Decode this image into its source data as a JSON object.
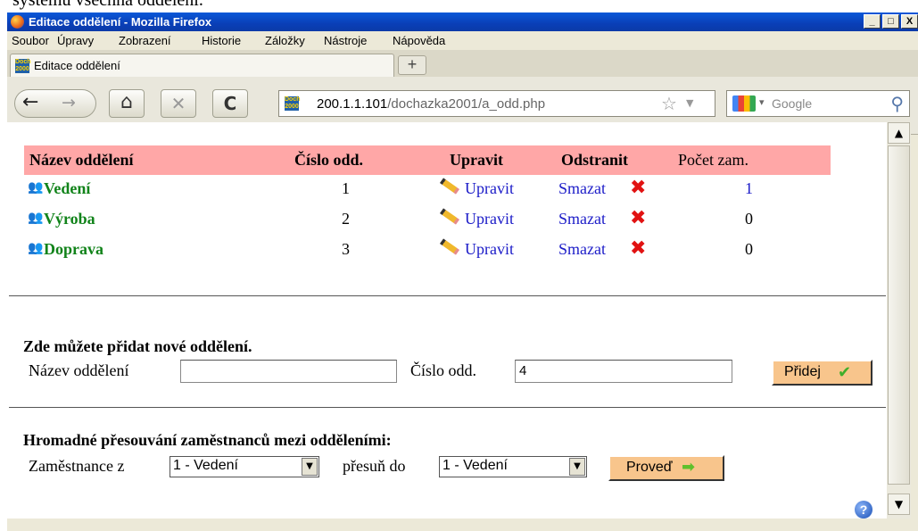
{
  "doc_cut_text": "systému všechna oddělení.",
  "window": {
    "title": "Editace oddělení - Mozilla Firefox",
    "min": "_",
    "max": "□",
    "close": "X"
  },
  "menu": {
    "items": [
      "Soubor",
      "Úpravy",
      "Zobrazení",
      "Historie",
      "Záložky",
      "Nástroje",
      "Nápověda"
    ]
  },
  "tab": {
    "label": "Editace oddělení",
    "favicon_text": "Doch 2000",
    "new_tab": "+"
  },
  "nav": {
    "back": "←",
    "forward": "→",
    "home": "⌂",
    "stop": "✕",
    "reload": "C",
    "url_host": "200.1.1.101",
    "url_path": "/dochazka2001/a_odd.php",
    "search_placeholder": "Google"
  },
  "table": {
    "headers": [
      "Název oddělení",
      "Číslo odd.",
      "Upravit",
      "Odstranit",
      "Počet zam."
    ],
    "rows": [
      {
        "name": "Vedení",
        "number": "1",
        "edit": "Upravit",
        "delete": "Smazat",
        "count": "1",
        "count_is_link": true
      },
      {
        "name": "Výroba",
        "number": "2",
        "edit": "Upravit",
        "delete": "Smazat",
        "count": "0",
        "count_is_link": false
      },
      {
        "name": "Doprava",
        "number": "3",
        "edit": "Upravit",
        "delete": "Smazat",
        "count": "0",
        "count_is_link": false
      }
    ]
  },
  "add_section": {
    "heading": "Zde můžete přidat nové oddělení.",
    "name_label": "Název oddělení",
    "name_value": "",
    "number_label": "Číslo odd.",
    "number_value": "4",
    "submit": "Přidej"
  },
  "move_section": {
    "heading": "Hromadné přesouvání zaměstnanců mezi odděleními:",
    "from_label": "Zaměstnance z",
    "from_value": "1 - Vedení",
    "to_label": "přesuň do",
    "to_value": "1 - Vedení",
    "submit": "Proveď"
  },
  "colors": {
    "header_bg": "#ffa7a7",
    "dept_green": "#11831a",
    "link_blue": "#1c1cc8",
    "button_bg": "#f8c58c"
  }
}
